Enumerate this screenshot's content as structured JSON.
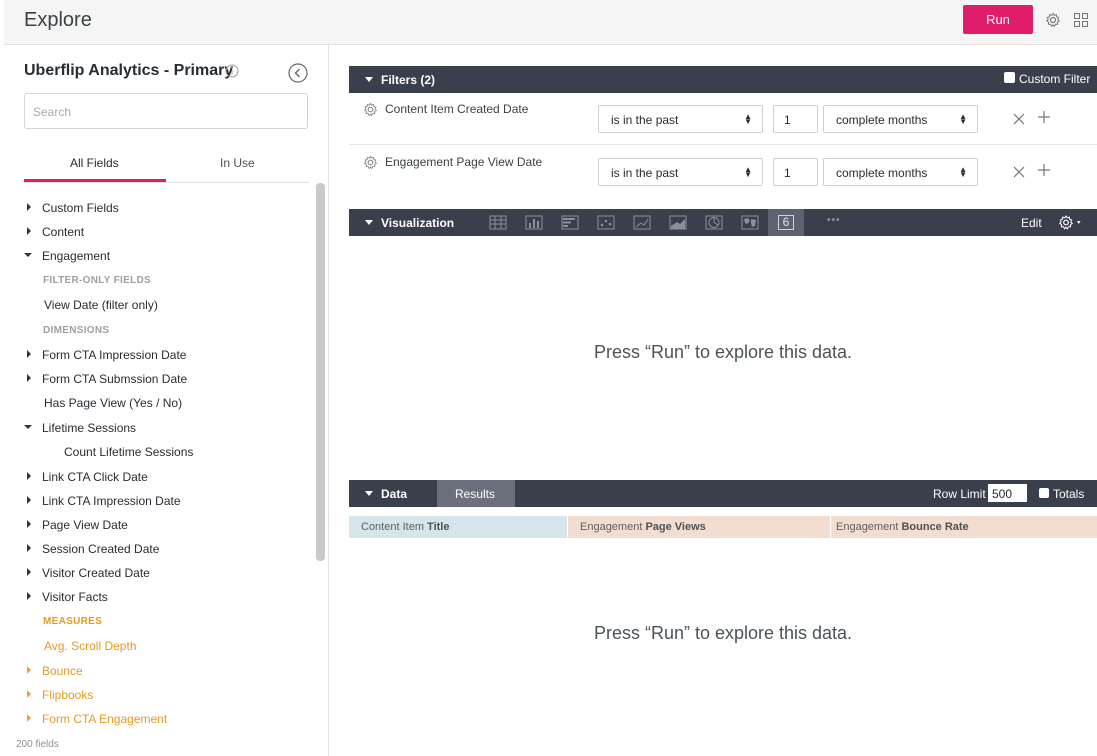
{
  "header": {
    "title": "Explore",
    "run_label": "Run"
  },
  "sidebar": {
    "model_name": "Uberflip Analytics - Primary",
    "search_placeholder": "Search",
    "tabs": [
      "All Fields",
      "In Use"
    ],
    "field_count": "200 fields",
    "items": [
      "Custom Fields",
      "Content",
      "Engagement",
      "FILTER-ONLY FIELDS",
      "View Date (filter only)",
      "DIMENSIONS",
      "Form CTA Impression Date",
      "Form CTA Submssion Date",
      "Has Page View (Yes / No)",
      "Lifetime Sessions",
      "Count Lifetime Sessions",
      "Link CTA Click Date",
      "Link CTA Impression Date",
      "Page View Date",
      "Session Created Date",
      "Visitor Created Date",
      "Visitor Facts",
      "MEASURES",
      "Avg. Scroll Depth",
      "Bounce",
      "Flipbooks",
      "Form CTA Engagement"
    ]
  },
  "filters": {
    "title": "Filters (2)",
    "custom_filter": "Custom Filter",
    "rows": [
      {
        "name": "Content Item Created Date",
        "op": "is in the past",
        "num": "1",
        "unit": "complete months"
      },
      {
        "name": "Engagement Page View Date",
        "op": "is in the past",
        "num": "1",
        "unit": "complete months"
      }
    ]
  },
  "viz": {
    "title": "Visualization",
    "edit": "Edit",
    "single_value_glyph": "6",
    "more": "•••",
    "placeholder": "Press “Run” to explore this data."
  },
  "data": {
    "title": "Data",
    "results_tab": "Results",
    "row_limit_label": "Row Limit",
    "row_limit": "500",
    "totals": "Totals",
    "columns": [
      {
        "prefix": "Content Item ",
        "name": "Title"
      },
      {
        "prefix": "Engagement ",
        "name": "Page Views"
      },
      {
        "prefix": "Engagement ",
        "name": "Bounce Rate"
      }
    ],
    "placeholder": "Press “Run” to explore this data."
  },
  "colors": {
    "accent": "#e01d6a",
    "bar": "#3a3f4c",
    "measure": "#e39b24",
    "dim_col": "#d6e4ec",
    "meas_col": "#f2ddd0"
  }
}
